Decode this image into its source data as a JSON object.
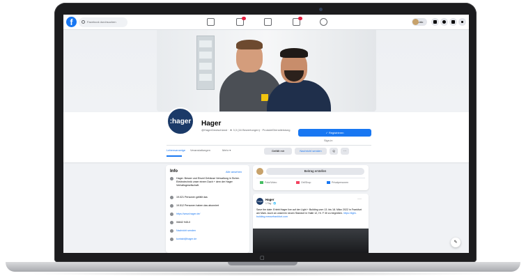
{
  "topbar": {
    "logo": "f",
    "search_placeholder": "Facebook durchsuchen",
    "user_name": "Udo",
    "nav_icons": [
      "home-icon",
      "flag-icon",
      "video-icon",
      "store-icon",
      "groups-icon"
    ],
    "right_icons": [
      "menu-icon",
      "messenger-icon",
      "bell-icon",
      "caret-icon"
    ]
  },
  "profile": {
    "avatar_text": ":hager",
    "name": "Hager",
    "subtitle": "@HagerDeutschland · ★ 3,3 (16 Bewertungen) · Produkt/Dienstleistung",
    "like_button": "✓ Registrieren",
    "sign_up": "Sign-in",
    "tabs": [
      "Lebensanzeige",
      "Veranstaltungen",
      "Mehr ▾"
    ],
    "actions": [
      "Gefällt mir",
      "Nachricht senden",
      "Q",
      "···"
    ]
  },
  "info": {
    "title": "Info",
    "edit": "Alle ansehen",
    "rows": [
      {
        "icon": "info-icon",
        "text": "Hager. Besser und Einzel Gehäuse Verwaltung in Sicher. Elektrotechnik unser einem Dach + dem der Hager Verhaltsgesellschaft.",
        "link": false
      },
      {
        "icon": "like-icon",
        "text": "19.021 Personen gefällt das",
        "link": false
      },
      {
        "icon": "follow-icon",
        "text": "19.512 Personen haben das abonniert",
        "link": false
      },
      {
        "icon": "globe-icon",
        "text": "https://www.hager.de/",
        "link": true
      },
      {
        "icon": "phone-icon",
        "text": "06842 945-0",
        "link": false
      },
      {
        "icon": "messenger-icon",
        "text": "Nachricht senden",
        "link": true
      },
      {
        "icon": "mail-icon",
        "text": "kontakt@hager.de",
        "link": true
      }
    ]
  },
  "composer": {
    "prompt": "Beitrag erstellen",
    "actions": [
      {
        "label": "Foto/Video",
        "color": "#45bd62"
      },
      {
        "label": "Ort/Shop",
        "color": "#f3425f"
      },
      {
        "label": "Privatpersonen",
        "color": "#1877f2"
      }
    ]
  },
  "post": {
    "author": "Hager",
    "time": "1 Tag · 🌐",
    "more": "···",
    "text": "Save the date: Erlebt Hager live auf der Light + Building vom 13. bis 18. März 2022 in Frankfurt am Main. Auch an unserem neuen Standort in Halle 12, Hi. F 30 zu begrüßen.",
    "link": "https://light-building.messefrankfurt.com"
  },
  "fab_icon": "compose-icon"
}
